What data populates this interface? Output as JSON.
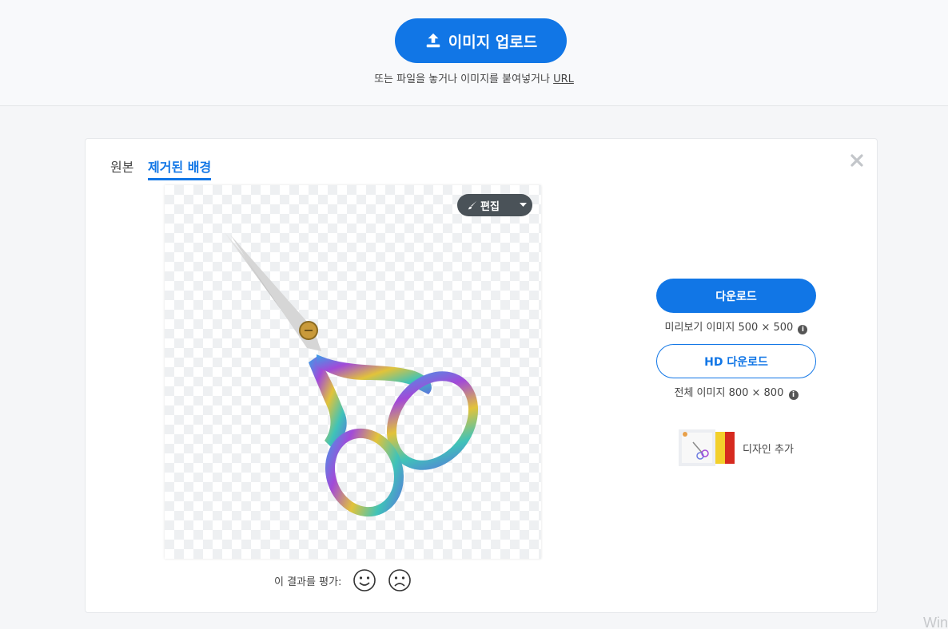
{
  "header": {
    "upload_label": "이미지 업로드",
    "drop_hint": "또는 파일을 놓거나 이미지를 붙여넣거나",
    "url_link": "URL"
  },
  "tabs": [
    {
      "label": "원본",
      "active": false
    },
    {
      "label": "제거된 배경",
      "active": true
    }
  ],
  "editor": {
    "edit_label": "편집"
  },
  "rating": {
    "prompt": "이 결과를 평가:"
  },
  "downloads": {
    "download_label": "다운로드",
    "preview_caption": "미리보기 이미지 500 × 500",
    "hd_label": "HD 다운로드",
    "full_caption": "전체 이미지 800 × 800"
  },
  "design": {
    "label": "디자인 추가"
  },
  "watermark": "Win",
  "colors": {
    "accent": "#1176e6",
    "edit_button": "#4a5258"
  },
  "icons": [
    "upload-icon",
    "close-icon",
    "brush-icon",
    "caret-down-icon",
    "smile-icon",
    "frown-icon",
    "info-icon"
  ]
}
